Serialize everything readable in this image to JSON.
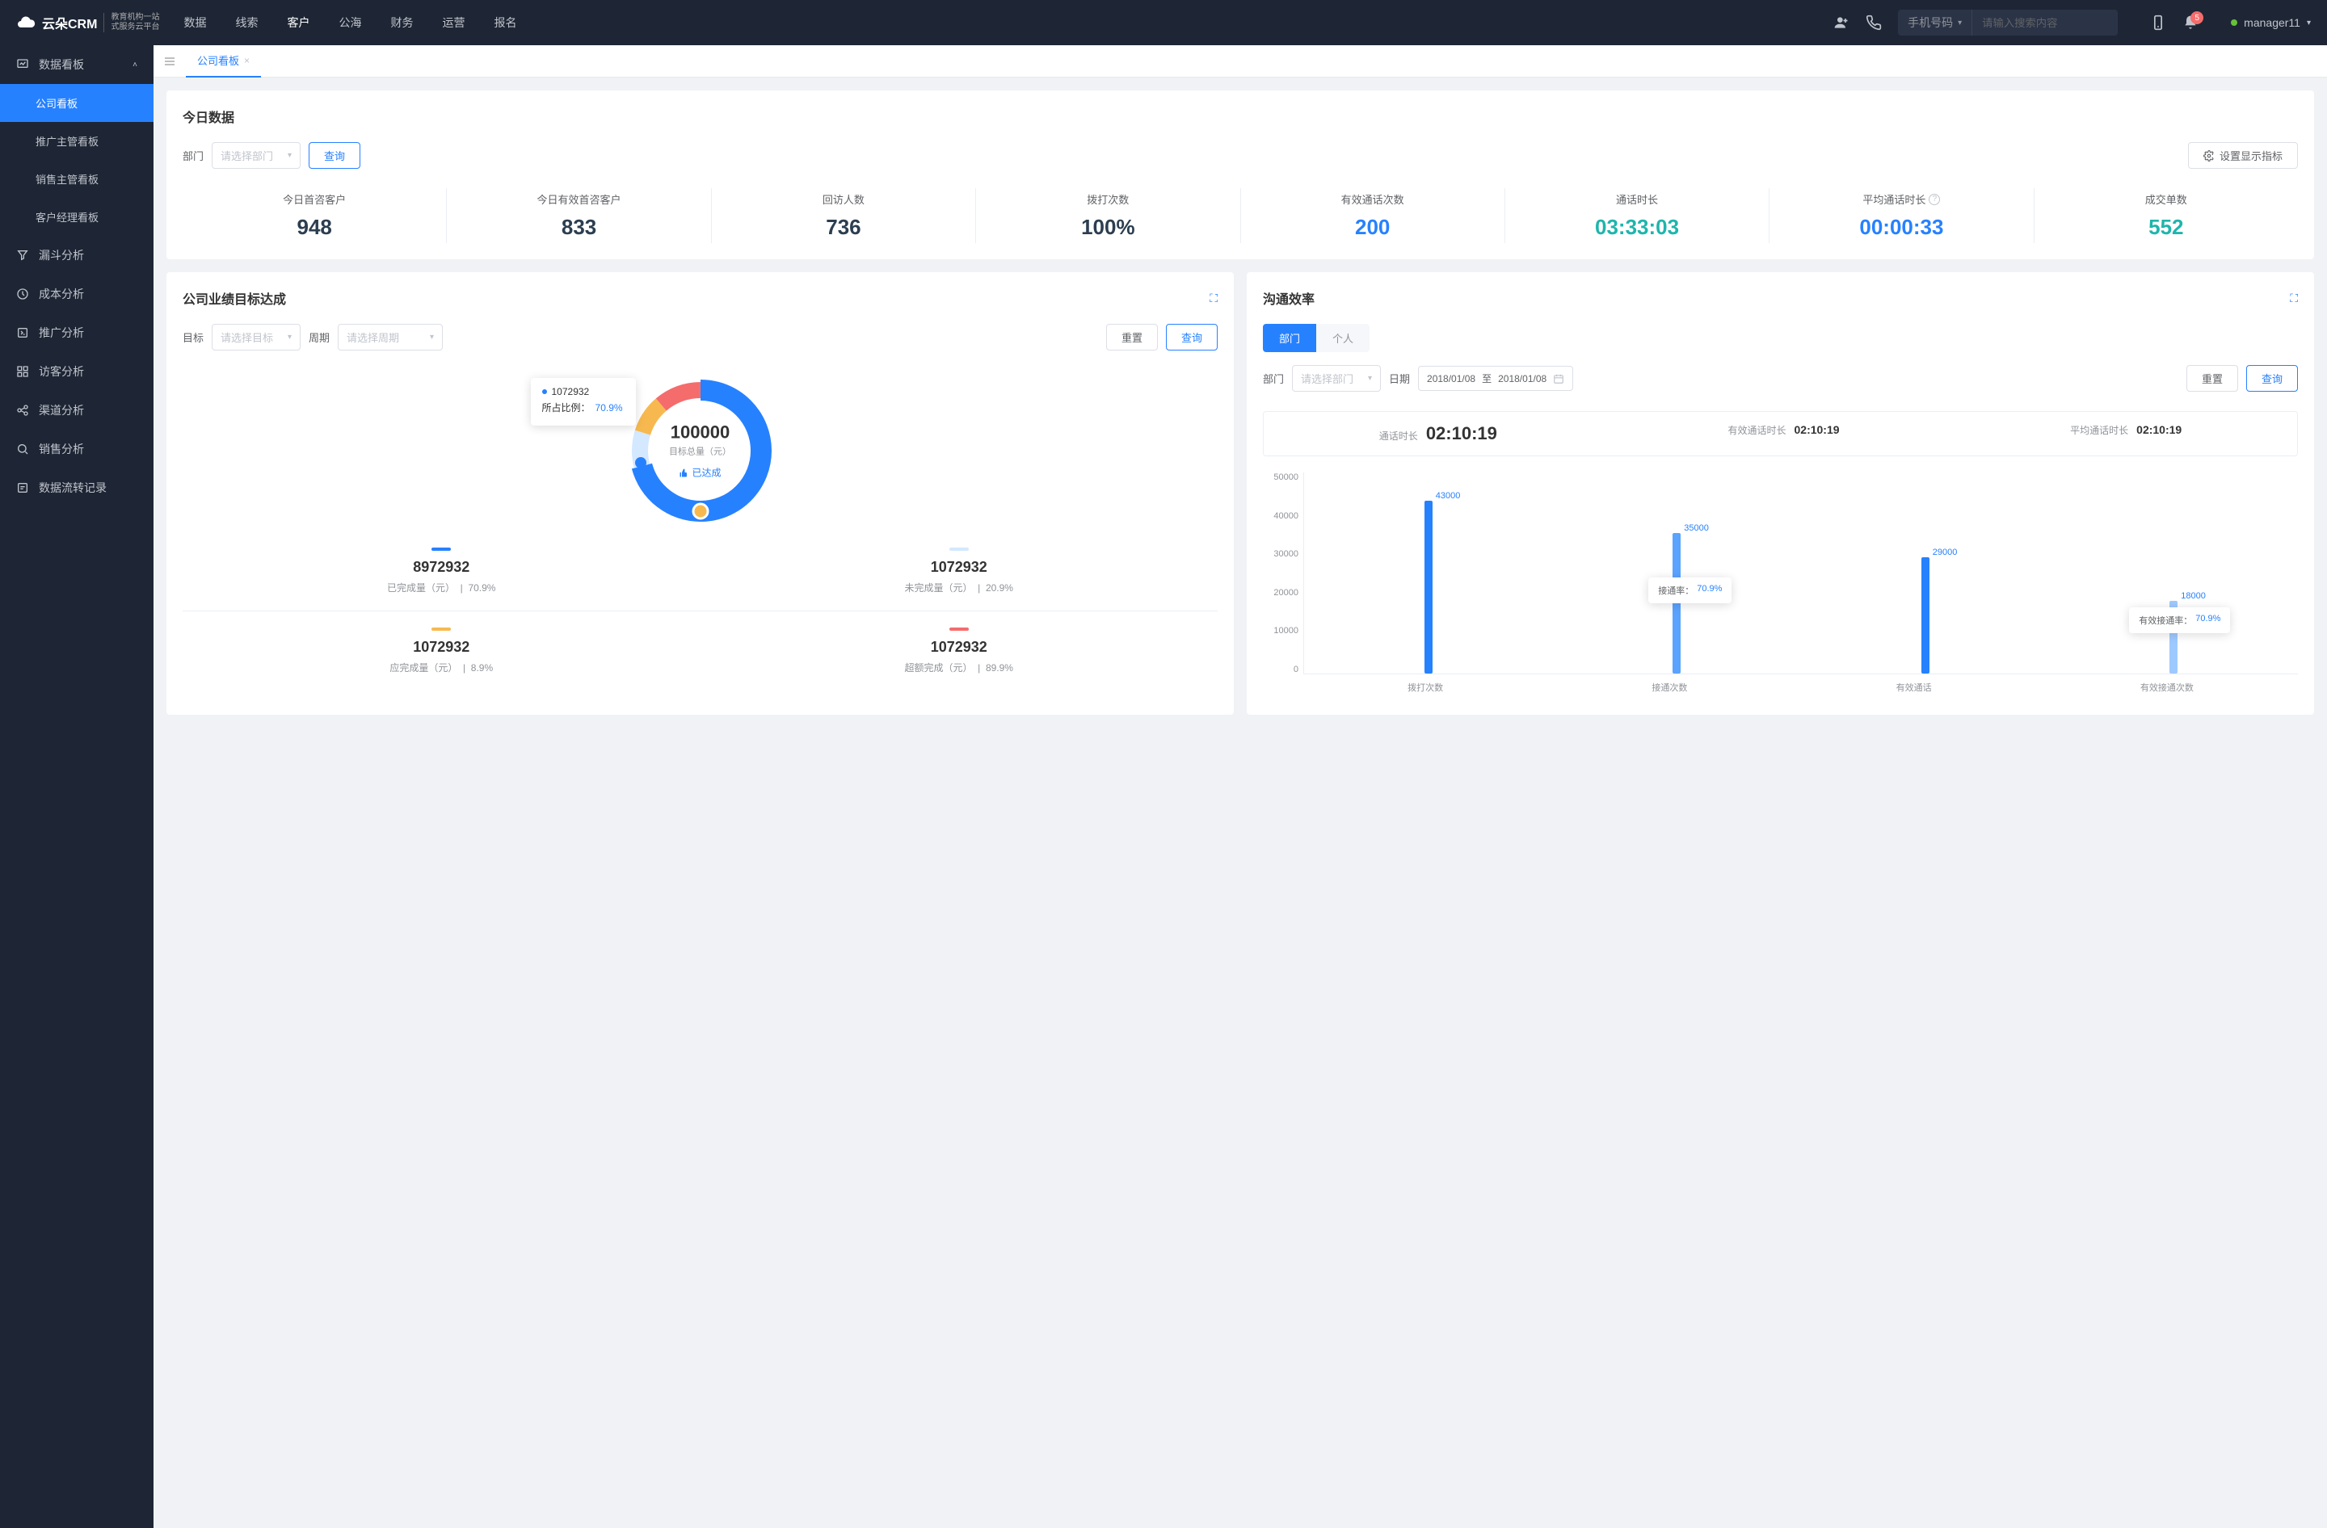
{
  "header": {
    "logo": "云朵CRM",
    "logo_sub1": "教育机构一站",
    "logo_sub2": "式服务云平台",
    "nav": [
      "数据",
      "线索",
      "客户",
      "公海",
      "财务",
      "运营",
      "报名"
    ],
    "nav_active": 2,
    "search_type": "手机号码",
    "search_placeholder": "请输入搜索内容",
    "badge": "5",
    "username": "manager11"
  },
  "sidebar": {
    "group_title": "数据看板",
    "items": [
      "公司看板",
      "推广主管看板",
      "销售主管看板",
      "客户经理看板"
    ],
    "active": 0,
    "singles": [
      "漏斗分析",
      "成本分析",
      "推广分析",
      "访客分析",
      "渠道分析",
      "销售分析",
      "数据流转记录"
    ]
  },
  "tabs": {
    "label": "公司看板"
  },
  "today": {
    "title": "今日数据",
    "dept_label": "部门",
    "dept_placeholder": "请选择部门",
    "query": "查询",
    "settings": "设置显示指标",
    "metrics": [
      {
        "label": "今日首咨客户",
        "value": "948",
        "color": "c-navy"
      },
      {
        "label": "今日有效首咨客户",
        "value": "833",
        "color": "c-navy"
      },
      {
        "label": "回访人数",
        "value": "736",
        "color": "c-navy"
      },
      {
        "label": "拨打次数",
        "value": "100%",
        "color": "c-navy"
      },
      {
        "label": "有效通话次数",
        "value": "200",
        "color": "c-blue"
      },
      {
        "label": "通话时长",
        "value": "03:33:03",
        "color": "c-teal"
      },
      {
        "label": "平均通话时长",
        "value": "00:00:33",
        "color": "c-blue",
        "info": true
      },
      {
        "label": "成交单数",
        "value": "552",
        "color": "c-teal"
      }
    ]
  },
  "target_panel": {
    "title": "公司业绩目标达成",
    "target_label": "目标",
    "target_placeholder": "请选择目标",
    "period_label": "周期",
    "period_placeholder": "请选择周期",
    "reset": "重置",
    "query": "查询",
    "center_value": "100000",
    "center_label": "目标总量（元）",
    "badge": "已达成",
    "tooltip_value": "1072932",
    "tooltip_ratio_label": "所占比例：",
    "tooltip_ratio": "70.9%",
    "legends": [
      {
        "color": "#2681ff",
        "value": "8972932",
        "label": "已完成量（元）",
        "pct": "70.9%"
      },
      {
        "color": "#d4e8ff",
        "value": "1072932",
        "label": "未完成量（元）",
        "pct": "20.9%"
      },
      {
        "color": "#f7b94f",
        "value": "1072932",
        "label": "应完成量（元）",
        "pct": "8.9%"
      },
      {
        "color": "#f56c6c",
        "value": "1072932",
        "label": "超额完成（元）",
        "pct": "89.9%"
      }
    ]
  },
  "comm_panel": {
    "title": "沟通效率",
    "tabs": [
      "部门",
      "个人"
    ],
    "tabs_active": 0,
    "dept_label": "部门",
    "dept_placeholder": "请选择部门",
    "date_label": "日期",
    "date_from": "2018/01/08",
    "date_to": "2018/01/08",
    "date_sep": "至",
    "reset": "重置",
    "query": "查询",
    "time_stats": [
      {
        "label": "通话时长",
        "value": "02:10:19",
        "big": true
      },
      {
        "label": "有效通话时长",
        "value": "02:10:19"
      },
      {
        "label": "平均通话时长",
        "value": "02:10:19"
      }
    ],
    "bar_tooltip1_label": "接通率：",
    "bar_tooltip1_value": "70.9%",
    "bar_tooltip2_label": "有效接通率：",
    "bar_tooltip2_value": "70.9%"
  },
  "chart_data": [
    {
      "type": "pie",
      "title": "公司业绩目标达成",
      "center_value": 100000,
      "center_label": "目标总量（元）",
      "series": [
        {
          "name": "已完成量（元）",
          "value": 8972932,
          "pct": 70.9,
          "color": "#2681ff"
        },
        {
          "name": "未完成量（元）",
          "value": 1072932,
          "pct": 20.9,
          "color": "#d4e8ff"
        },
        {
          "name": "应完成量（元）",
          "value": 1072932,
          "pct": 8.9,
          "color": "#f7b94f"
        },
        {
          "name": "超额完成（元）",
          "value": 1072932,
          "pct": 89.9,
          "color": "#f56c6c"
        }
      ],
      "tooltip": {
        "value": 1072932,
        "ratio": 70.9
      }
    },
    {
      "type": "bar",
      "title": "沟通效率",
      "categories": [
        "拨打次数",
        "接通次数",
        "有效通话",
        "有效接通次数"
      ],
      "values": [
        43000,
        35000,
        29000,
        18000
      ],
      "ylabel": "",
      "xlabel": "",
      "ylim": [
        0,
        50000
      ],
      "yticks": [
        0,
        10000,
        20000,
        30000,
        40000,
        50000
      ],
      "bar_colors": [
        "#2681ff",
        "#5aa3ff",
        "#2681ff",
        "#9ec9ff"
      ],
      "annotations": [
        {
          "x": 1,
          "label": "接通率：",
          "value": "70.9%"
        },
        {
          "x": 3,
          "label": "有效接通率：",
          "value": "70.9%"
        }
      ]
    }
  ]
}
